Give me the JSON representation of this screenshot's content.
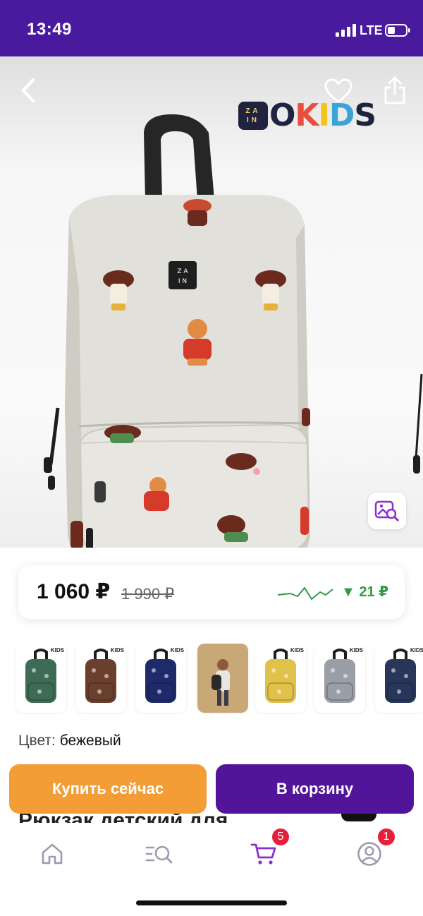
{
  "status": {
    "time": "13:49",
    "network": "LTE"
  },
  "header": {
    "brand_logo": {
      "badge_text": "ZA\nIN",
      "text": "OKIDS",
      "letter_colors": [
        "#1f2340",
        "#e94e3c",
        "#f4c21a",
        "#3aa3d8",
        "#1f2340"
      ]
    },
    "icons": [
      "chevron-left-icon",
      "heart-icon",
      "share-icon"
    ]
  },
  "product": {
    "image_search_icon": "image-search-icon"
  },
  "price": {
    "current": "1 060 ₽",
    "old": "1 990 ₽",
    "drop": "▼ 21 ₽",
    "accent_color": "#2f9a43"
  },
  "variants": [
    {
      "color": "#3d6b55",
      "type": "backpack"
    },
    {
      "color": "#6a3f2e",
      "type": "backpack"
    },
    {
      "color": "#1f2a6b",
      "type": "backpack"
    },
    {
      "color": "#c9a878",
      "type": "photo"
    },
    {
      "color": "#e0c24a",
      "type": "backpack"
    },
    {
      "color": "#9a9ea6",
      "type": "backpack"
    },
    {
      "color": "#283659",
      "type": "backpack"
    }
  ],
  "variant_mini_logo": "KIDS",
  "color": {
    "label": "Цвет:",
    "value": "бежевый"
  },
  "title_peek": "Рюкзак детский для",
  "actions": {
    "buy_now": "Купить сейчас",
    "add_to_cart": "В корзину",
    "buy_color": "#f29d36",
    "cart_color": "#521599"
  },
  "tabbar": {
    "cart_badge": "5",
    "profile_badge": "1",
    "active_color": "#8c2fd0",
    "inactive_color": "#9b9bb0"
  }
}
